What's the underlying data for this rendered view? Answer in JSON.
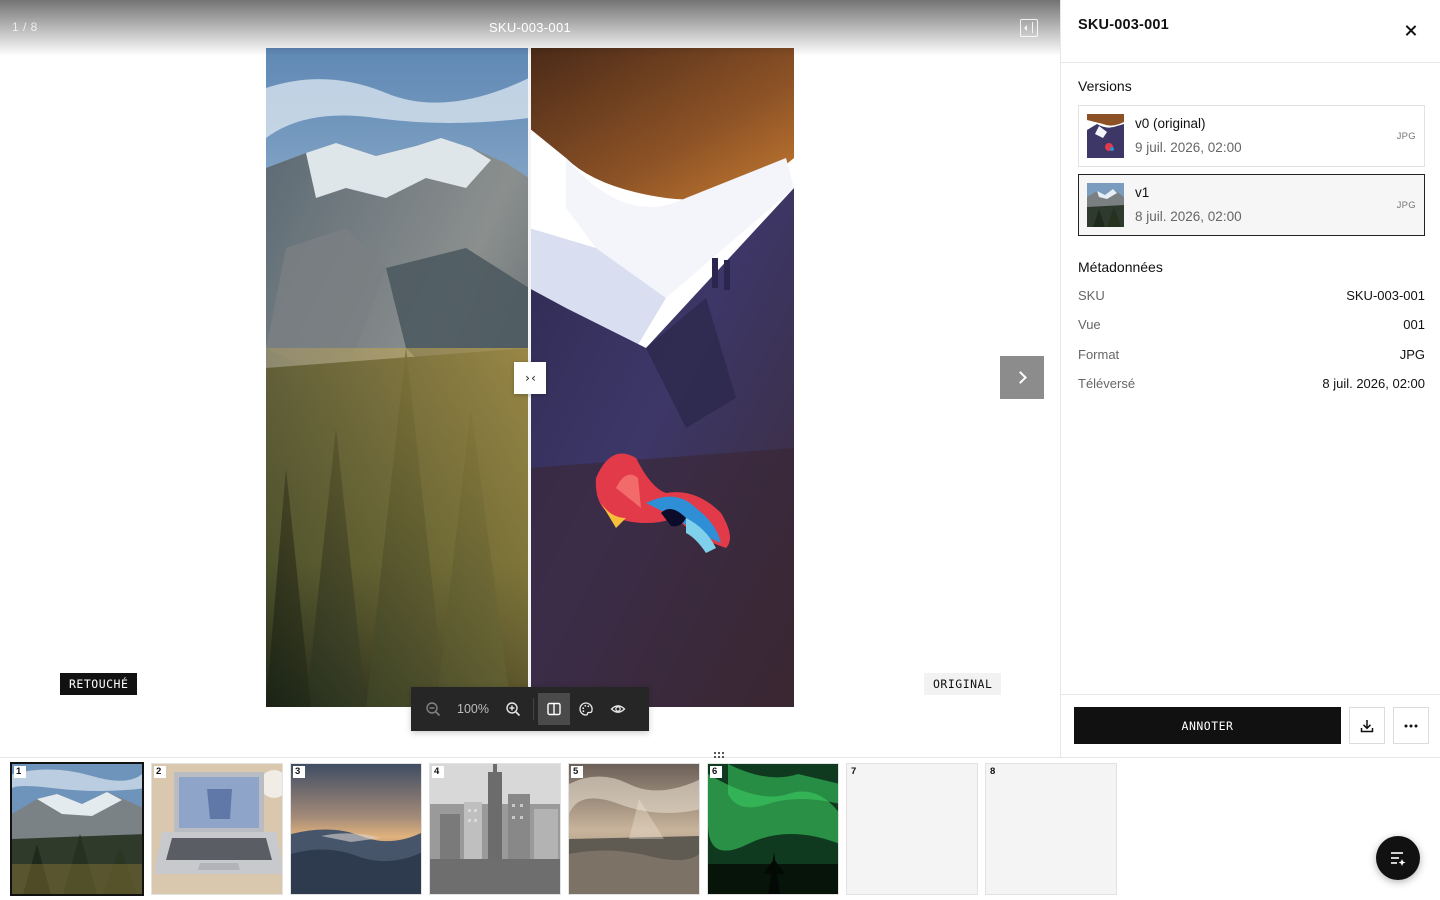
{
  "viewer": {
    "counter": "1 / 8",
    "title": "SKU-003-001",
    "label_left": "RETOUCHÉ",
    "label_right": "ORIGINAL",
    "split_handle_glyph": "›‹",
    "zoom": "100%",
    "icons": [
      "zoom-out-icon",
      "zoom-in-icon",
      "compare-split-icon",
      "palette-icon",
      "eye-icon",
      "panel-toggle-icon",
      "chevron-right-icon"
    ]
  },
  "panel": {
    "title": "SKU-003-001",
    "versions_title": "Versions",
    "versions": [
      {
        "name": "v0 (original)",
        "date": "9 juil. 2026, 02:00",
        "format": "JPG"
      },
      {
        "name": "v1",
        "date": "8 juil. 2026, 02:00",
        "format": "JPG"
      }
    ],
    "metadata_title": "Métadonnées",
    "metadata": [
      {
        "key": "SKU",
        "value": "SKU-003-001"
      },
      {
        "key": "Vue",
        "value": "001"
      },
      {
        "key": "Format",
        "value": "JPG"
      },
      {
        "key": "Téléversé",
        "value": "8 juil. 2026, 02:00"
      }
    ],
    "annotate_label": "ANNOTER"
  },
  "filmstrip": {
    "items": [
      {
        "num": "1",
        "subject": "mountain"
      },
      {
        "num": "2",
        "subject": "laptop"
      },
      {
        "num": "3",
        "subject": "ocean-sunset"
      },
      {
        "num": "4",
        "subject": "city"
      },
      {
        "num": "5",
        "subject": "sea-clouds"
      },
      {
        "num": "6",
        "subject": "aurora"
      },
      {
        "num": "7",
        "subject": "empty"
      },
      {
        "num": "8",
        "subject": "empty"
      }
    ]
  },
  "colors": {
    "accent": "#111111",
    "panel_border": "#e6e6e6",
    "toolbar_bg": "#262626"
  }
}
